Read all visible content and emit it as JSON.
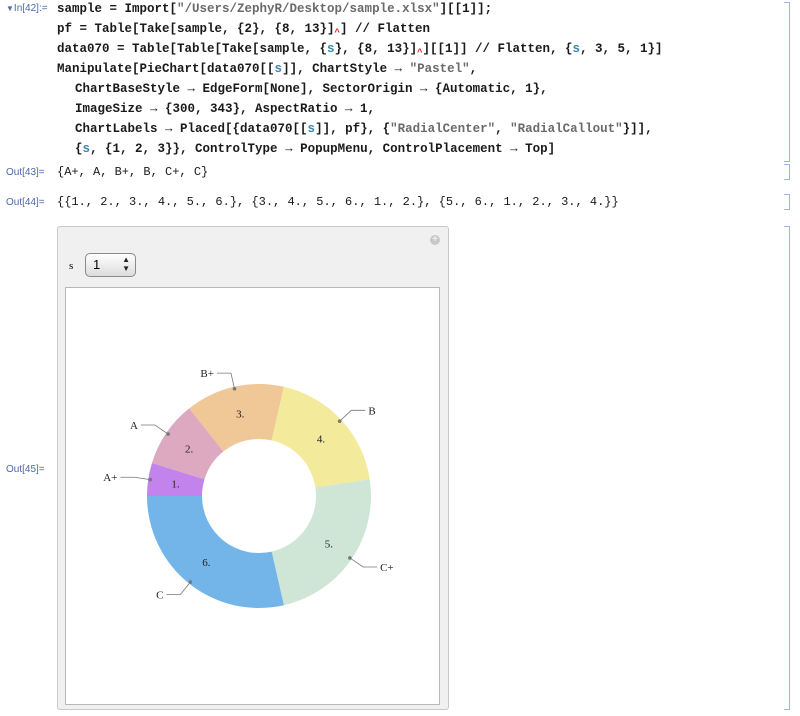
{
  "cells": {
    "in42_label": "In[42]:=",
    "line1_a": "sample = Import[",
    "line1_str": "\"/Users/ZephyR/Desktop/sample.xlsx\"",
    "line1_b": "][[1]];",
    "line2": "pf = Table[Take[sample, {2}, {8, 13}]",
    "line2_b": "] // Flatten",
    "line3_a": "data070 = Table[Table[Take[sample, {",
    "line3_var": "s",
    "line3_b": "}, {8, 13}]",
    "line3_c": "][[1]] // Flatten, {",
    "line3_var2": "s",
    "line3_d": ", 3, 5, 1}]",
    "line4_a": "Manipulate[PieChart[data070[[",
    "line4_var": "s",
    "line4_b": "]], ChartStyle → ",
    "line4_str": "\"Pastel\"",
    "line4_c": ",",
    "line5": "ChartBaseStyle → EdgeForm[None], SectorOrigin → {Automatic, 1},",
    "line6": "ImageSize → {300, 343}, AspectRatio → 1,",
    "line7_a": "ChartLabels → Placed[{data070[[",
    "line7_var": "s",
    "line7_b": "]], pf}, {",
    "line7_str1": "\"RadialCenter\"",
    "line7_c": ", ",
    "line7_str2": "\"RadialCallout\"",
    "line7_d": "}]],",
    "line8_a": "{",
    "line8_var": "s",
    "line8_b": ", {1, 2, 3}}, ControlType → PopupMenu, ControlPlacement → Top]",
    "out43_label": "Out[43]=",
    "out43": "{A+, A, B+, B, C+, C}",
    "out44_label": "Out[44]=",
    "out44": "{{1., 2., 3., 4., 5., 6.}, {3., 4., 5., 6., 1., 2.}, {5., 6., 1., 2., 3., 4.}}",
    "out45_label": "Out[45]="
  },
  "manipulate": {
    "control_label": "s",
    "popup_value": "1",
    "popup_options": [
      "1",
      "2",
      "3"
    ]
  },
  "chart_data": {
    "type": "pie",
    "style": "donut",
    "categories": [
      "A+",
      "A",
      "B+",
      "B",
      "C+",
      "C"
    ],
    "values": [
      1,
      2,
      3,
      4,
      5,
      6
    ],
    "value_labels": [
      "1.",
      "2.",
      "3.",
      "4.",
      "5.",
      "6."
    ],
    "colors": [
      "#c283ec",
      "#dca9c0",
      "#f0c796",
      "#f4ea9c",
      "#cfe6d6",
      "#74b5e9"
    ],
    "label_placement_values": "radial-center",
    "label_placement_categories": "radial-callout"
  },
  "icons": {
    "plus": "add-pane-icon",
    "popup_arrows": "up-down-arrows-icon"
  }
}
